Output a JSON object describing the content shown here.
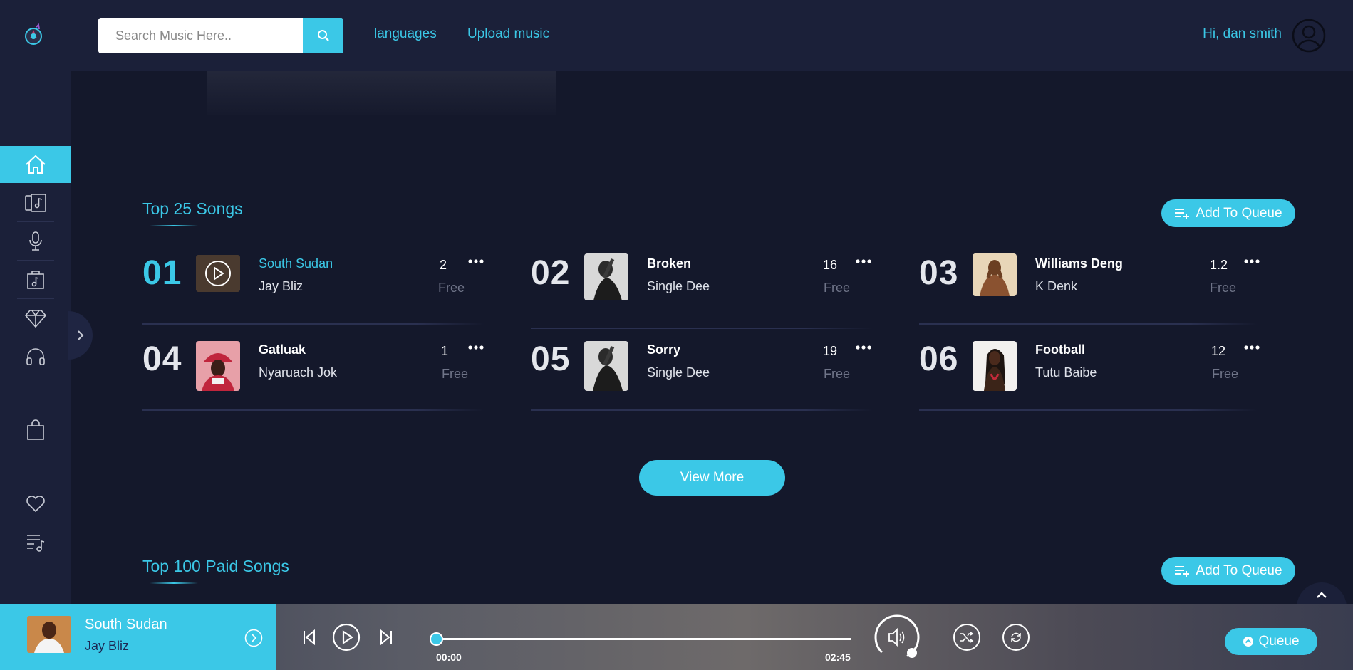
{
  "header": {
    "search_placeholder": "Search Music Here..",
    "nav_languages": "languages",
    "nav_upload": "Upload music",
    "greeting": "Hi, dan smith"
  },
  "sidebar": {
    "icons": [
      "home-icon",
      "albums-icon",
      "microphone-icon",
      "music-file-icon",
      "diamond-icon",
      "headphones-icon",
      "shopping-bag-icon",
      "heart-icon",
      "playlist-icon"
    ],
    "active": "home-icon"
  },
  "top25": {
    "title": "Top 25 Songs",
    "queue_label": "Add To Queue",
    "songs": [
      {
        "rank": "01",
        "name": "South Sudan",
        "artist": "Jay Bliz",
        "count": "2",
        "price": "Free"
      },
      {
        "rank": "02",
        "name": "Broken",
        "artist": "Single Dee",
        "count": "16",
        "price": "Free"
      },
      {
        "rank": "03",
        "name": "Williams Deng",
        "artist": "K Denk",
        "count": "1.2",
        "price": "Free"
      },
      {
        "rank": "04",
        "name": "Gatluak",
        "artist": "Nyaruach Jok",
        "count": "1",
        "price": "Free"
      },
      {
        "rank": "05",
        "name": "Sorry",
        "artist": "Single Dee",
        "count": "19",
        "price": "Free"
      },
      {
        "rank": "06",
        "name": "Football",
        "artist": "Tutu Baibe",
        "count": "12",
        "price": "Free"
      }
    ],
    "view_more": "View More"
  },
  "top100": {
    "title": "Top 100 Paid Songs",
    "queue_label": "Add To Queue"
  },
  "player": {
    "title": "South Sudan",
    "artist": "Jay Bliz",
    "time_current": "00:00",
    "time_total": "02:45",
    "progress": 0,
    "queue_label": "Queue"
  },
  "colors": {
    "accent": "#3bc8e7",
    "background": "#14182b",
    "panel": "#1b2039"
  }
}
